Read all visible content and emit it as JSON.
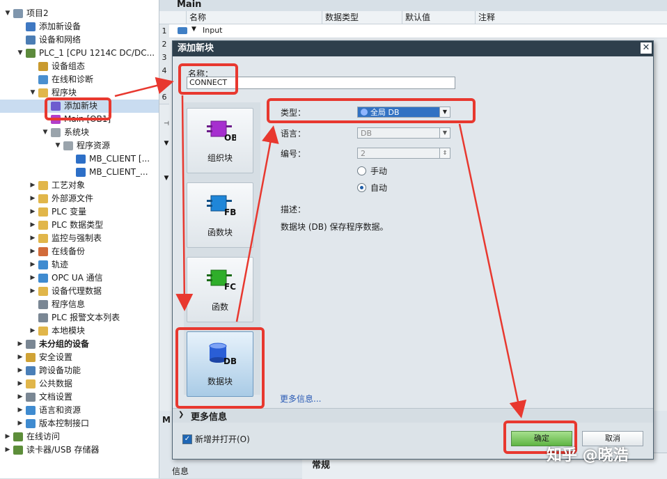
{
  "tree": {
    "items": [
      {
        "label": "项目2",
        "indent": 0,
        "toggle": "▼",
        "icon": "#7f96ad"
      },
      {
        "label": "添加新设备",
        "indent": 1,
        "toggle": "",
        "icon": "#3f78c2"
      },
      {
        "label": "设备和网络",
        "indent": 1,
        "toggle": "",
        "icon": "#4b7db4"
      },
      {
        "label": "PLC_1 [CPU 1214C DC/DC...",
        "indent": 1,
        "toggle": "▼",
        "icon": "#5c8a3c"
      },
      {
        "label": "设备组态",
        "indent": 2,
        "toggle": "",
        "icon": "#c99a2e"
      },
      {
        "label": "在线和诊断",
        "indent": 2,
        "toggle": "",
        "icon": "#4a8fcf"
      },
      {
        "label": "程序块",
        "indent": 2,
        "toggle": "▼",
        "icon": "#e1b64a"
      },
      {
        "label": "添加新块",
        "indent": 3,
        "toggle": "",
        "icon": "#6d5ccf"
      },
      {
        "label": "Main [OB1]",
        "indent": 3,
        "toggle": "",
        "icon": "#b23fc9"
      },
      {
        "label": "系统块",
        "indent": 3,
        "toggle": "▼",
        "icon": "#9aa4ac"
      },
      {
        "label": "程序资源",
        "indent": 4,
        "toggle": "▼",
        "icon": "#9aa4ac"
      },
      {
        "label": "MB_CLIENT [...",
        "indent": 5,
        "toggle": "",
        "icon": "#2d6fc7"
      },
      {
        "label": "MB_CLIENT_...",
        "indent": 5,
        "toggle": "",
        "icon": "#2d6fc7"
      },
      {
        "label": "工艺对象",
        "indent": 2,
        "toggle": "▶",
        "icon": "#e1b64a"
      },
      {
        "label": "外部源文件",
        "indent": 2,
        "toggle": "▶",
        "icon": "#e1b64a"
      },
      {
        "label": "PLC 变量",
        "indent": 2,
        "toggle": "▶",
        "icon": "#e1b64a"
      },
      {
        "label": "PLC 数据类型",
        "indent": 2,
        "toggle": "▶",
        "icon": "#e1b64a"
      },
      {
        "label": "监控与强制表",
        "indent": 2,
        "toggle": "▶",
        "icon": "#e1b64a"
      },
      {
        "label": "在线备份",
        "indent": 2,
        "toggle": "▶",
        "icon": "#d26b3a"
      },
      {
        "label": "轨迹",
        "indent": 2,
        "toggle": "▶",
        "icon": "#3f8bd0"
      },
      {
        "label": "OPC UA 通信",
        "indent": 2,
        "toggle": "▶",
        "icon": "#3f8bd0"
      },
      {
        "label": "设备代理数据",
        "indent": 2,
        "toggle": "▶",
        "icon": "#e1b64a"
      },
      {
        "label": "程序信息",
        "indent": 2,
        "toggle": "",
        "icon": "#7a8794"
      },
      {
        "label": "PLC 报警文本列表",
        "indent": 2,
        "toggle": "",
        "icon": "#7a8794"
      },
      {
        "label": "本地模块",
        "indent": 2,
        "toggle": "▶",
        "icon": "#e1b64a"
      },
      {
        "label": "未分组的设备",
        "indent": 1,
        "toggle": "▶",
        "icon": "#7a8794",
        "bold": true
      },
      {
        "label": "安全设置",
        "indent": 1,
        "toggle": "▶",
        "icon": "#d0a336"
      },
      {
        "label": "跨设备功能",
        "indent": 1,
        "toggle": "▶",
        "icon": "#4a7fb8"
      },
      {
        "label": "公共数据",
        "indent": 1,
        "toggle": "▶",
        "icon": "#e1b64a"
      },
      {
        "label": "文档设置",
        "indent": 1,
        "toggle": "▶",
        "icon": "#7a8794"
      },
      {
        "label": "语言和资源",
        "indent": 1,
        "toggle": "▶",
        "icon": "#3f8bd0"
      },
      {
        "label": "版本控制接口",
        "indent": 1,
        "toggle": "▶",
        "icon": "#3f8bd0"
      },
      {
        "label": "在线访问",
        "indent": 0,
        "toggle": "▶",
        "icon": "#5d8e3a"
      },
      {
        "label": "读卡器/USB 存储器",
        "indent": 0,
        "toggle": "▶",
        "icon": "#5d8e3a"
      }
    ],
    "selected_index": 7
  },
  "editor": {
    "title": "Main",
    "columns": [
      "名称",
      "数据类型",
      "默认值",
      "注释"
    ],
    "rows": [
      "1",
      "2",
      "3",
      "4",
      "5",
      "6"
    ],
    "row1_name": "Input",
    "bottom_label": "常规",
    "bottom_left_label": "信息"
  },
  "dialog": {
    "title": "添加新块",
    "close": "✕",
    "name_label": "名称：",
    "name_value": "CONNECT",
    "tiles": [
      {
        "badge": "OB",
        "label": "组织块",
        "color": "#a62fcf"
      },
      {
        "badge": "FB",
        "label": "函数块",
        "color": "#1f86d8"
      },
      {
        "badge": "FC",
        "label": "函数",
        "color": "#2fae2a"
      },
      {
        "badge": "DB",
        "label": "数据块",
        "color": "#2a5ed6"
      }
    ],
    "selected_tile": 3,
    "type_label": "类型：",
    "type_value": "全局 DB",
    "language_label": "语言：",
    "language_value": "DB",
    "number_label": "编号：",
    "number_value": "2",
    "radio_manual": "手动",
    "radio_auto": "自动",
    "description_label": "描述：",
    "description_text": "数据块 (DB) 保存程序数据。",
    "more_info_link": "更多信息...",
    "more_info_bar": "更多信息",
    "add_and_open": "新增并打开(O)",
    "ok": "确定",
    "cancel": "取消"
  },
  "watermark": "知乎 @晓浩",
  "colors": {
    "annotation": "#e8382f",
    "title_bar": "#2e3f4c",
    "selected_type": "#3272c3"
  }
}
